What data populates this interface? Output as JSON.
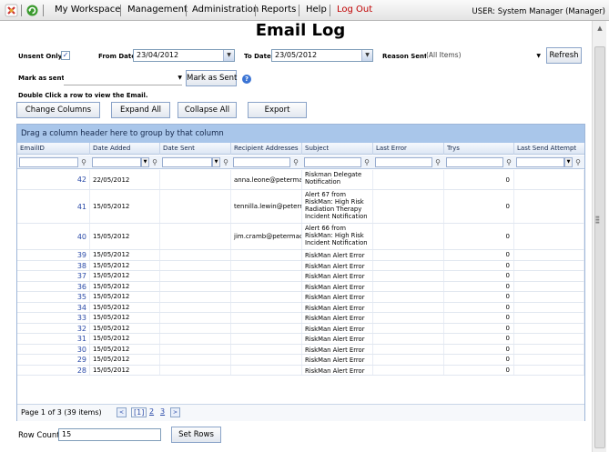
{
  "nav": {
    "links": [
      "My Workspace",
      "Management",
      "Administration",
      "Reports",
      "Help",
      "Log Out"
    ],
    "user": "USER: System Manager (Manager)"
  },
  "title": "Email Log",
  "filters": {
    "unsent_only_label": "Unsent Only",
    "unsent_only_checked": true,
    "from_date_label": "From Date",
    "from_date": "23/04/2012",
    "to_date_label": "To Date",
    "to_date": "23/05/2012",
    "reason_sent_label": "Reason Sent",
    "reason_sent": "(All Items)",
    "refresh_label": "Refresh",
    "mark_as_sent_label": "Mark as sent",
    "mark_as_sent_value": "",
    "mark_as_sent_button": "Mark as Sent"
  },
  "instructions": "Double Click a row to view the Email.",
  "toolbar": {
    "change_columns": "Change Columns",
    "expand_all": "Expand All",
    "collapse_all": "Collapse All",
    "export": "Export"
  },
  "grid": {
    "group_bar": "Drag a column header here to group by that column",
    "columns": [
      "EmailID",
      "Date Added",
      "Date Sent",
      "Recipient Addresses",
      "Subject",
      "Last Error",
      "Trys",
      "Last Send Attempt"
    ],
    "rows": [
      {
        "id": "42",
        "date_added": "22/05/2012",
        "date_sent": "",
        "recipient": "anna.leone@petermac.",
        "subject": "Riskman Delegate Notification",
        "last_error": "",
        "trys": "0",
        "last_attempt": ""
      },
      {
        "id": "41",
        "date_added": "15/05/2012",
        "date_sent": "",
        "recipient": "tennilla.lewin@peterma",
        "subject": "Alert 67 from RiskMan: High Risk Radiation Therapy Incident Notification",
        "last_error": "",
        "trys": "0",
        "last_attempt": ""
      },
      {
        "id": "40",
        "date_added": "15/05/2012",
        "date_sent": "",
        "recipient": "jim.cramb@petermac.c",
        "subject": "Alert 66 from RiskMan: High Risk Incident Notification",
        "last_error": "",
        "trys": "0",
        "last_attempt": ""
      },
      {
        "id": "39",
        "date_added": "15/05/2012",
        "date_sent": "",
        "recipient": "",
        "subject": "RiskMan Alert Error",
        "last_error": "",
        "trys": "0",
        "last_attempt": ""
      },
      {
        "id": "38",
        "date_added": "15/05/2012",
        "date_sent": "",
        "recipient": "",
        "subject": "RiskMan Alert Error",
        "last_error": "",
        "trys": "0",
        "last_attempt": ""
      },
      {
        "id": "37",
        "date_added": "15/05/2012",
        "date_sent": "",
        "recipient": "",
        "subject": "RiskMan Alert Error",
        "last_error": "",
        "trys": "0",
        "last_attempt": ""
      },
      {
        "id": "36",
        "date_added": "15/05/2012",
        "date_sent": "",
        "recipient": "",
        "subject": "RiskMan Alert Error",
        "last_error": "",
        "trys": "0",
        "last_attempt": ""
      },
      {
        "id": "35",
        "date_added": "15/05/2012",
        "date_sent": "",
        "recipient": "",
        "subject": "RiskMan Alert Error",
        "last_error": "",
        "trys": "0",
        "last_attempt": ""
      },
      {
        "id": "34",
        "date_added": "15/05/2012",
        "date_sent": "",
        "recipient": "",
        "subject": "RiskMan Alert Error",
        "last_error": "",
        "trys": "0",
        "last_attempt": ""
      },
      {
        "id": "33",
        "date_added": "15/05/2012",
        "date_sent": "",
        "recipient": "",
        "subject": "RiskMan Alert Error",
        "last_error": "",
        "trys": "0",
        "last_attempt": ""
      },
      {
        "id": "32",
        "date_added": "15/05/2012",
        "date_sent": "",
        "recipient": "",
        "subject": "RiskMan Alert Error",
        "last_error": "",
        "trys": "0",
        "last_attempt": ""
      },
      {
        "id": "31",
        "date_added": "15/05/2012",
        "date_sent": "",
        "recipient": "",
        "subject": "RiskMan Alert Error",
        "last_error": "",
        "trys": "0",
        "last_attempt": ""
      },
      {
        "id": "30",
        "date_added": "15/05/2012",
        "date_sent": "",
        "recipient": "",
        "subject": "RiskMan Alert Error",
        "last_error": "",
        "trys": "0",
        "last_attempt": ""
      },
      {
        "id": "29",
        "date_added": "15/05/2012",
        "date_sent": "",
        "recipient": "",
        "subject": "RiskMan Alert Error",
        "last_error": "",
        "trys": "0",
        "last_attempt": ""
      },
      {
        "id": "28",
        "date_added": "15/05/2012",
        "date_sent": "",
        "recipient": "",
        "subject": "RiskMan Alert Error",
        "last_error": "",
        "trys": "0",
        "last_attempt": ""
      }
    ],
    "pager": {
      "summary": "Page 1 of 3 (39 items)",
      "prev": "<",
      "pages": [
        "[1]",
        "2",
        "3"
      ],
      "next": ">"
    }
  },
  "row_count": {
    "label": "Row Count",
    "value": "15",
    "set_rows_label": "Set Rows"
  },
  "colors": {
    "group_bar": "#a9c6ea",
    "link_blue": "#2a4aa8",
    "logout_red": "#c00000"
  },
  "icons": [
    "riskman-logo-icon",
    "refresh-icon",
    "help-icon",
    "filter-icon",
    "dropdown-arrow-icon"
  ]
}
